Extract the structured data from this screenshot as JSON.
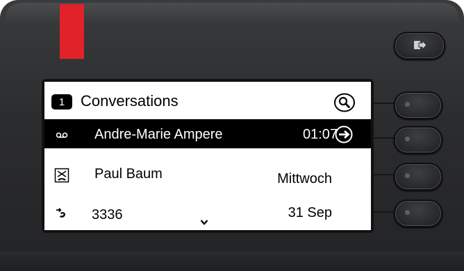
{
  "screen": {
    "header": {
      "line_number": "1",
      "title": "Conversations",
      "search_icon": "search-icon"
    },
    "rows": [
      {
        "icon": "voicemail-icon",
        "name": "Andre-Marie Ampere",
        "meta": "01:07",
        "action_icon": "arrow-right-circle-icon",
        "selected": true
      },
      {
        "icon": "missed-call-icon",
        "name": "Paul Baum",
        "meta": "Mittwoch",
        "selected": false
      },
      {
        "icon": "call-forwarded-icon",
        "name": "3336",
        "meta": "31 Sep",
        "selected": false
      }
    ],
    "scroll_icon": "chevron-down-icon"
  },
  "hardware": {
    "logout_icon": "logout-icon",
    "led_color": "#e2222a",
    "softkeys": [
      "softkey-1",
      "softkey-2",
      "softkey-3",
      "softkey-4"
    ]
  }
}
